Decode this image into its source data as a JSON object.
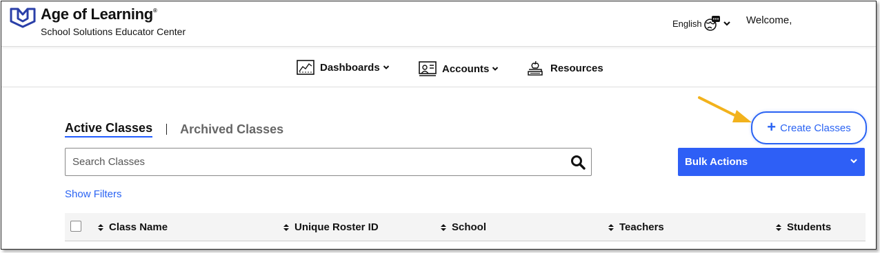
{
  "header": {
    "brand": "Age of Learning",
    "brand_mark": "®",
    "subtitle": "School Solutions Educator Center",
    "language": "English",
    "welcome": "Welcome,"
  },
  "nav": {
    "items": [
      {
        "label": "Dashboards",
        "icon": "dashboard-chart-icon",
        "has_dropdown": true
      },
      {
        "label": "Accounts",
        "icon": "accounts-board-icon",
        "has_dropdown": true
      },
      {
        "label": "Resources",
        "icon": "books-apple-icon",
        "has_dropdown": false
      }
    ]
  },
  "tabs": {
    "active": "Active Classes",
    "archived": "Archived Classes"
  },
  "actions": {
    "create_label": "Create Classes",
    "create_icon": "plus-icon",
    "bulk_label": "Bulk Actions"
  },
  "search": {
    "placeholder": "Search Classes",
    "value": ""
  },
  "filters": {
    "label": "Show Filters"
  },
  "table": {
    "columns": [
      "Class Name",
      "Unique Roster ID",
      "School",
      "Teachers",
      "Students"
    ]
  },
  "colors": {
    "accent": "#2e5ff6",
    "brand": "#2a3fa8",
    "annotation_arrow": "#f2b21c"
  }
}
